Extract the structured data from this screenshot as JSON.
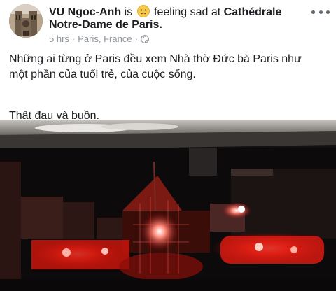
{
  "post": {
    "author": "VU Ngoc-Anh",
    "is_text": "is",
    "feeling_text": "feeling sad at",
    "place_line1": "Cathédrale",
    "place_line2": "Notre-Dame de Paris.",
    "time": "5 hrs",
    "location": "Paris, France",
    "separator": "·",
    "feeling_icon": "sad-face-icon",
    "privacy_icon": "globe-icon",
    "more_icon": "more-dots-icon",
    "text_line1": "Những ai từng ở Paris đều xem Nhà thờ Đức bà Paris như",
    "text_line2": "một phần của tuổi trẻ, của cuộc sống.",
    "text_line3": "Thật đau và buồn.",
    "accent_color": "#ff2a1a"
  }
}
